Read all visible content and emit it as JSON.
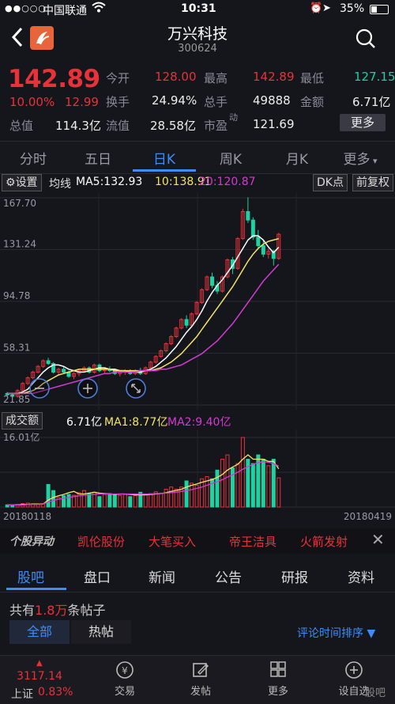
{
  "status": {
    "carrier": "中国联通",
    "time": "10:31",
    "battery": "35%"
  },
  "header": {
    "name": "万兴科技",
    "code": "300624"
  },
  "quote": {
    "price": "142.89",
    "pct": "10.00%",
    "change": "12.99",
    "open_label": "今开",
    "open": "128.00",
    "high_label": "最高",
    "high": "142.89",
    "low_label": "最低",
    "low": "127.15",
    "turnover_label": "换手",
    "turnover": "24.94%",
    "volume_label": "总手",
    "volume": "49888",
    "amount_label": "金额",
    "amount": "6.71亿",
    "mcap_label": "总值",
    "mcap": "114.3亿",
    "float_label": "流值",
    "float": "28.58亿",
    "pe_label": "市盈",
    "pe_sup": "动",
    "pe": "121.69",
    "more": "更多"
  },
  "tabs": [
    "分时",
    "五日",
    "日K",
    "周K",
    "月K",
    "更多"
  ],
  "chart_header": {
    "settings": "设置",
    "ma_label": "均线",
    "ma5": "MA5:132.93",
    "ma10": "10:138.91",
    "ma20": "20:120.87",
    "dk": "DK点",
    "fq": "前复权"
  },
  "price_axis": [
    "167.70",
    "131.24",
    "94.78",
    "58.31",
    "21.85"
  ],
  "volume_header": {
    "label": "成交额",
    "value": "6.71亿",
    "ma1": "MA1:8.77亿",
    "ma2": "MA2:9.40亿"
  },
  "volume_axis_top": "16.01亿",
  "dates": {
    "start": "20180118",
    "end": "20180419"
  },
  "news": {
    "tag": "个股异动",
    "items": [
      "凯伦股份",
      "大笔买入",
      "帝王洁具",
      "火箭发射"
    ]
  },
  "tabs2": [
    "股吧",
    "盘口",
    "新闻",
    "公告",
    "研报",
    "资料"
  ],
  "forum": {
    "total_prefix": "共有",
    "total_num": "1.8万",
    "total_suffix": "条帖子",
    "filter_all": "全部",
    "filter_hot": "热帖",
    "sort": "评论时间排序"
  },
  "bottom": {
    "index_value": "3117.14",
    "index_name": "上证",
    "index_pct": "0.83%",
    "items": [
      "交易",
      "发帖",
      "更多",
      "设自选"
    ]
  },
  "watermark": "股吧",
  "colors": {
    "up": "#e8323a",
    "down": "#1fd1a0",
    "accent": "#3e8df5",
    "ma5": "#ffffff",
    "ma10": "#f2e46b",
    "ma20": "#d23ccf"
  },
  "chart_data": {
    "type": "candlestick",
    "ylim": [
      21.85,
      167.7
    ],
    "candles": [
      [
        30,
        31,
        28,
        29
      ],
      [
        29,
        30,
        27,
        28
      ],
      [
        28,
        33,
        27,
        32
      ],
      [
        32,
        38,
        31,
        37
      ],
      [
        37,
        42,
        36,
        41
      ],
      [
        41,
        46,
        40,
        45
      ],
      [
        45,
        50,
        44,
        49
      ],
      [
        49,
        54,
        48,
        53
      ],
      [
        53,
        55,
        50,
        51
      ],
      [
        51,
        52,
        44,
        45
      ],
      [
        45,
        48,
        43,
        47
      ],
      [
        47,
        49,
        44,
        45
      ],
      [
        45,
        46,
        41,
        42
      ],
      [
        42,
        45,
        40,
        44
      ],
      [
        44,
        47,
        42,
        46
      ],
      [
        46,
        49,
        45,
        48
      ],
      [
        48,
        49,
        44,
        45
      ],
      [
        45,
        51,
        44,
        50
      ],
      [
        50,
        51,
        45,
        46
      ],
      [
        46,
        48,
        44,
        47
      ],
      [
        47,
        49,
        45,
        46
      ],
      [
        46,
        47,
        43,
        44
      ],
      [
        44,
        46,
        42,
        45
      ],
      [
        45,
        47,
        43,
        46
      ],
      [
        46,
        47,
        43,
        44
      ],
      [
        44,
        47,
        43,
        46
      ],
      [
        46,
        48,
        43,
        44
      ],
      [
        44,
        49,
        43,
        48
      ],
      [
        48,
        53,
        47,
        52
      ],
      [
        52,
        57,
        51,
        56
      ],
      [
        56,
        61,
        55,
        60
      ],
      [
        60,
        66,
        59,
        65
      ],
      [
        65,
        71,
        64,
        70
      ],
      [
        70,
        77,
        69,
        76
      ],
      [
        76,
        83,
        75,
        82
      ],
      [
        82,
        85,
        76,
        78
      ],
      [
        78,
        87,
        77,
        86
      ],
      [
        86,
        95,
        85,
        94
      ],
      [
        94,
        104,
        93,
        103
      ],
      [
        103,
        113,
        102,
        112
      ],
      [
        112,
        115,
        104,
        106
      ],
      [
        106,
        109,
        100,
        102
      ],
      [
        102,
        113,
        101,
        112
      ],
      [
        112,
        125,
        111,
        124
      ],
      [
        124,
        126,
        114,
        118
      ],
      [
        118,
        140,
        117,
        139
      ],
      [
        139,
        160,
        138,
        158
      ],
      [
        158,
        168,
        150,
        152
      ],
      [
        152,
        154,
        138,
        140
      ],
      [
        140,
        145,
        132,
        134
      ],
      [
        134,
        138,
        126,
        128
      ],
      [
        128,
        132,
        125,
        130
      ],
      [
        130,
        131,
        120,
        125
      ],
      [
        125,
        143,
        124,
        142
      ]
    ],
    "ma5": [
      30,
      30,
      30,
      31,
      33,
      37,
      41,
      45,
      48,
      50,
      50,
      49,
      47,
      46,
      45,
      45,
      46,
      47,
      48,
      48,
      47,
      47,
      46,
      46,
      45,
      45,
      45,
      46,
      47,
      49,
      52,
      55,
      59,
      63,
      68,
      73,
      77,
      82,
      88,
      95,
      101,
      106,
      110,
      115,
      120,
      126,
      132,
      138,
      141,
      141,
      138,
      133,
      129,
      132.93
    ],
    "ma10": [
      30,
      30,
      30,
      30,
      31,
      32,
      34,
      37,
      39,
      41,
      43,
      44,
      45,
      46,
      47,
      47,
      47,
      47,
      47,
      47,
      47,
      46,
      46,
      46,
      46,
      46,
      46,
      46,
      46,
      47,
      48,
      50,
      52,
      55,
      58,
      62,
      66,
      70,
      75,
      80,
      85,
      90,
      95,
      100,
      105,
      111,
      117,
      123,
      128,
      132,
      135,
      137,
      138,
      138.91
    ],
    "ma20": [
      30,
      30,
      30,
      30,
      30,
      30,
      31,
      32,
      33,
      34,
      35,
      36,
      37,
      38,
      39,
      40,
      41,
      42,
      43,
      44,
      44,
      45,
      45,
      45,
      45,
      45,
      46,
      46,
      46,
      46,
      47,
      47,
      48,
      49,
      50,
      52,
      54,
      56,
      58,
      61,
      64,
      67,
      71,
      75,
      79,
      84,
      89,
      94,
      99,
      104,
      109,
      113,
      117,
      120.87
    ],
    "volume": [
      0.5,
      0.4,
      0.6,
      0.8,
      0.9,
      0.7,
      0.6,
      0.8,
      5.2,
      3.8,
      2.2,
      2.6,
      2.9,
      2.7,
      3.3,
      3.8,
      3.1,
      3.4,
      2.4,
      2.9,
      3.1,
      2.9,
      2.7,
      2.9,
      2.4,
      2.6,
      3.4,
      3.0,
      3.1,
      3.5,
      3.2,
      4.1,
      4.6,
      4.1,
      4.6,
      6.0,
      5.5,
      5.0,
      6.5,
      7.0,
      6.5,
      8.5,
      11.0,
      12.0,
      9.0,
      10.0,
      16.0,
      11.0,
      10.0,
      12.0,
      11.0,
      9.5,
      11.0,
      6.71
    ],
    "vol_ma1": [
      0.5,
      0.5,
      0.5,
      0.6,
      0.6,
      0.7,
      0.7,
      0.7,
      1.6,
      2.2,
      2.6,
      2.9,
      3.3,
      3.6,
      3.0,
      3.0,
      3.2,
      3.4,
      3.2,
      3.1,
      3.0,
      2.9,
      3.0,
      3.0,
      2.9,
      2.8,
      2.8,
      2.8,
      2.9,
      3.0,
      3.1,
      3.3,
      3.6,
      3.8,
      4.1,
      4.6,
      5.0,
      5.3,
      5.7,
      6.0,
      6.3,
      6.8,
      7.5,
      8.5,
      9.2,
      9.8,
      11.0,
      12.0,
      11.0,
      11.0,
      11.0,
      10.5,
      10.5,
      8.77
    ],
    "vol_ma2": [
      0.5,
      0.5,
      0.5,
      0.5,
      0.6,
      0.6,
      0.6,
      0.7,
      1.2,
      1.5,
      1.8,
      2.0,
      2.2,
      2.4,
      2.6,
      2.7,
      2.8,
      2.9,
      3.0,
      3.0,
      3.0,
      3.0,
      3.0,
      3.0,
      3.0,
      3.0,
      3.0,
      3.0,
      3.0,
      3.1,
      3.1,
      3.2,
      3.3,
      3.4,
      3.6,
      3.8,
      4.0,
      4.3,
      4.6,
      5.0,
      5.4,
      5.8,
      6.3,
      6.9,
      7.4,
      8.0,
      8.7,
      9.3,
      9.8,
      10.2,
      10.4,
      10.3,
      10.0,
      9.4
    ]
  }
}
